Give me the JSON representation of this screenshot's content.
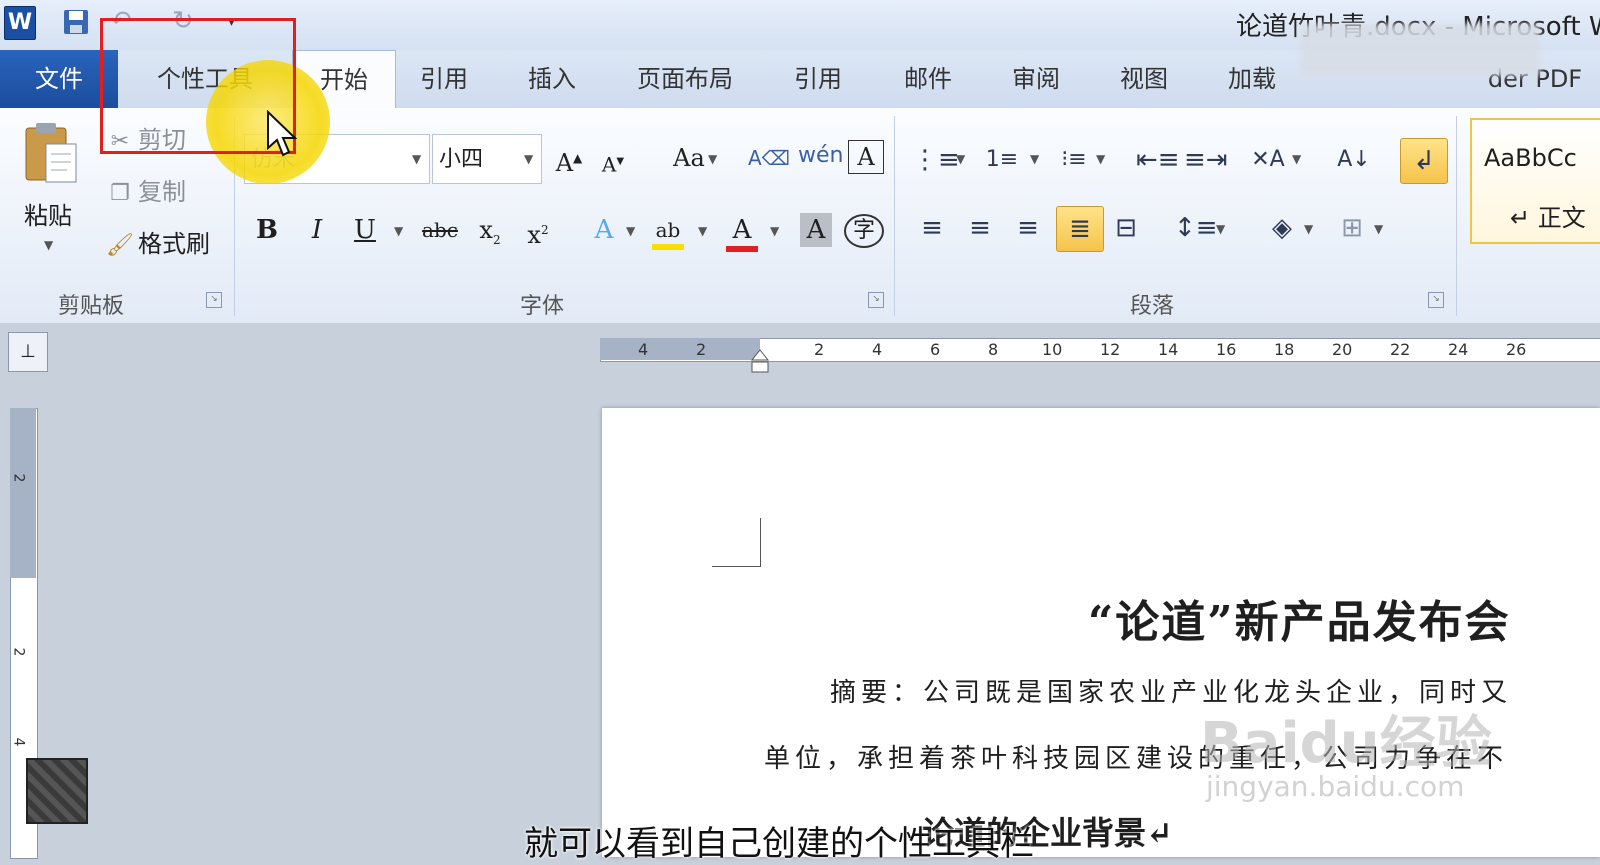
{
  "window": {
    "title": "论道竹叶青.docx - Microsoft W",
    "app_icon": "W"
  },
  "quick_access": {
    "save_icon": "save-icon",
    "undo_glyph": "↶",
    "redo_glyph": "↻",
    "customize_glyph": "▾"
  },
  "tabs": [
    {
      "label": "文件",
      "active": false
    },
    {
      "label": "个性工具",
      "active": false
    },
    {
      "label": "开始",
      "active": true
    },
    {
      "label": "引用",
      "active": false
    },
    {
      "label": "插入",
      "active": false
    },
    {
      "label": "页面布局",
      "active": false
    },
    {
      "label": "引用",
      "active": false
    },
    {
      "label": "邮件",
      "active": false
    },
    {
      "label": "审阅",
      "active": false
    },
    {
      "label": "视图",
      "active": false
    },
    {
      "label": "加载",
      "active": false
    },
    {
      "label": "der PDF",
      "active": false
    }
  ],
  "clipboard": {
    "paste": "粘贴",
    "cut": "剪切",
    "copy": "复制",
    "format_painter": "格式刷",
    "group_label": "剪贴板"
  },
  "font": {
    "name": "仿宋",
    "size": "小四",
    "group_label": "字体"
  },
  "paragraph": {
    "group_label": "段落"
  },
  "styles": {
    "sample": "AaBbCc",
    "name": "↵ 正文"
  },
  "ruler": {
    "ticks": [
      "4",
      "2",
      "2",
      "4",
      "6",
      "8",
      "10",
      "12",
      "14",
      "16",
      "18",
      "20",
      "22",
      "24",
      "26"
    ],
    "vertical_ticks": [
      "2",
      "2",
      "4"
    ]
  },
  "document": {
    "heading": "“论道”新产品发布会",
    "para1": "摘要：公司既是国家农业产业化龙头企业，同时又",
    "para2": "单位，承担着茶叶科技园区建设的重任，公司力争在不",
    "subheading": "论道的企业背景↵"
  },
  "overlay": {
    "subtitle": "就可以看到自己创建的个性工具栏",
    "watermark": "Baidu经验",
    "watermark_url": "jingyan.baidu.com"
  },
  "colors": {
    "file_tab": "#1b4d9c",
    "highlight": "#f5d600",
    "annotation_box": "#e02020",
    "font_color_bar": "#e02020",
    "highlighter_bar": "#f5e000"
  }
}
